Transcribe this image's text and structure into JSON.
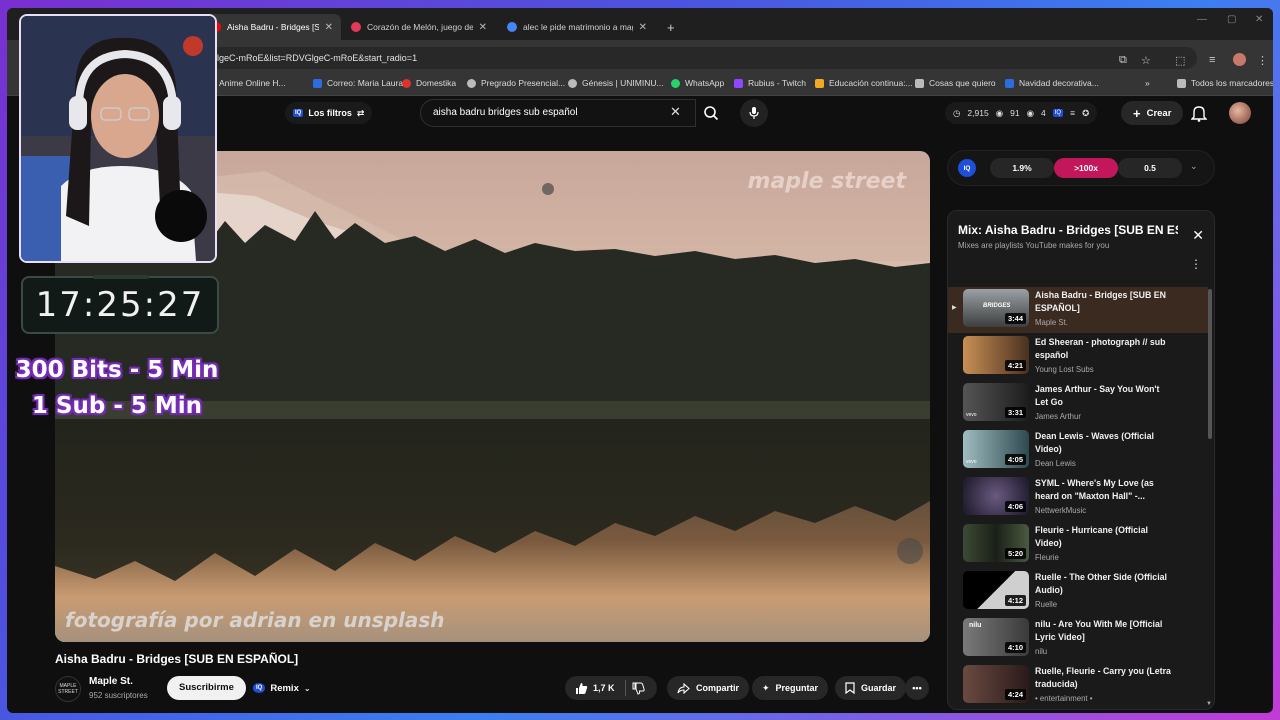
{
  "browser": {
    "tabs": [
      {
        "title": "Aisha Badru - Bridges [SUB EN",
        "color": "#ff0000"
      },
      {
        "title": "Corazón de Melón, juego de a",
        "color": "#e23b5a"
      },
      {
        "title": "alec le pide matrimonio a mag",
        "color": "#4285f4"
      }
    ],
    "new_tab": "+",
    "url": "lgeC-mRoE&list=RDVGlgeC-mRoE&start_radio=1",
    "bookmarks": [
      {
        "label": "Anime Online H...",
        "color": "#2b6de0"
      },
      {
        "label": "Correo: Maria Laura...",
        "color": "#2b6de0"
      },
      {
        "label": "Domestika",
        "color": "#e0312b"
      },
      {
        "label": "Pregrado Presencial...",
        "color": "#bbbbbb"
      },
      {
        "label": "Génesis | UNIMINU...",
        "color": "#bbbbbb"
      },
      {
        "label": "WhatsApp",
        "color": "#25d366"
      },
      {
        "label": "Rubius - Twitch",
        "color": "#9146ff"
      },
      {
        "label": "Educación continua:...",
        "color": "#f5a623"
      },
      {
        "label": "Cosas que quiero",
        "color": "#bbbbbb"
      },
      {
        "label": "Navidad decorativa...",
        "color": "#2b6de0"
      }
    ],
    "all_bookmarks": "Todos los marcadores"
  },
  "youtube": {
    "filters_label": "Los filtros",
    "search_query": "aisha badru bridges sub español",
    "stats": [
      "2,915",
      "91",
      "4"
    ],
    "create_label": "Crear"
  },
  "video": {
    "watermark_top": "maple street",
    "watermark_bottom": "fotografía por adrian en unsplash",
    "title": "Aisha Badru - Bridges [SUB EN ESPAÑOL]",
    "channel": "Maple St.",
    "channel_logo": "MAPLE STREET",
    "subscribers": "952 suscriptores",
    "subscribe_label": "Suscribirme",
    "remix_label": "Remix",
    "likes": "1,7 K",
    "share_label": "Compartir",
    "ask_label": "Preguntar",
    "save_label": "Guardar"
  },
  "iq": {
    "badge": "IQ",
    "stats": [
      "1.9%",
      ">100x",
      "0.5"
    ]
  },
  "playlist": {
    "title": "Mix: Aisha Badru - Bridges [SUB EN ESPAÑOL]",
    "subtitle": "Mixes are playlists YouTube makes for you",
    "items": [
      {
        "title": "Aisha Badru - Bridges [SUB EN ESPAÑOL]",
        "channel": "Maple St.",
        "duration": "3:44",
        "thumb": "#8a8f94",
        "thumb_label": "BRIDGES"
      },
      {
        "title": "Ed Sheeran - photograph // sub español",
        "channel": "Young Lost Subs",
        "duration": "4:21",
        "thumb": "#7a5a3a",
        "thumb_label": ""
      },
      {
        "title": "James Arthur - Say You Won't Let Go",
        "channel": "James Arthur",
        "duration": "3:31",
        "thumb": "#3a3a3a",
        "thumb_label": "vevo"
      },
      {
        "title": "Dean Lewis - Waves (Official Video)",
        "channel": "Dean Lewis",
        "duration": "4:05",
        "thumb": "#6d8a8f",
        "thumb_label": "vevo"
      },
      {
        "title": "SYML - Where's My Love (as heard on \"Maxton Hall\" -...",
        "channel": "NettwerkMusic",
        "duration": "4:06",
        "thumb": "#2a2440",
        "thumb_label": ""
      },
      {
        "title": "Fleurie - Hurricane (Official Video)",
        "channel": "Fleurie",
        "duration": "5:20",
        "thumb": "#2f3a2a",
        "thumb_label": ""
      },
      {
        "title": "Ruelle - The Other Side (Official Audio)",
        "channel": "Ruelle",
        "duration": "4:12",
        "thumb": "#1c1c1c",
        "thumb_label": ""
      },
      {
        "title": "nilu - Are You With Me [Official Lyric Video]",
        "channel": "nilu",
        "duration": "4:10",
        "thumb": "#5a5a5a",
        "thumb_label": "nilu"
      },
      {
        "title": "Ruelle, Fleurie - Carry you (Letra traducida)",
        "channel": "• entertainment •",
        "duration": "4:24",
        "thumb": "#3a2a2a",
        "thumb_label": ""
      }
    ]
  },
  "overlay": {
    "timer": "17:25:27",
    "bits_line1": "300 Bits - 5 Min",
    "bits_line2": "1 Sub - 5 Min"
  }
}
